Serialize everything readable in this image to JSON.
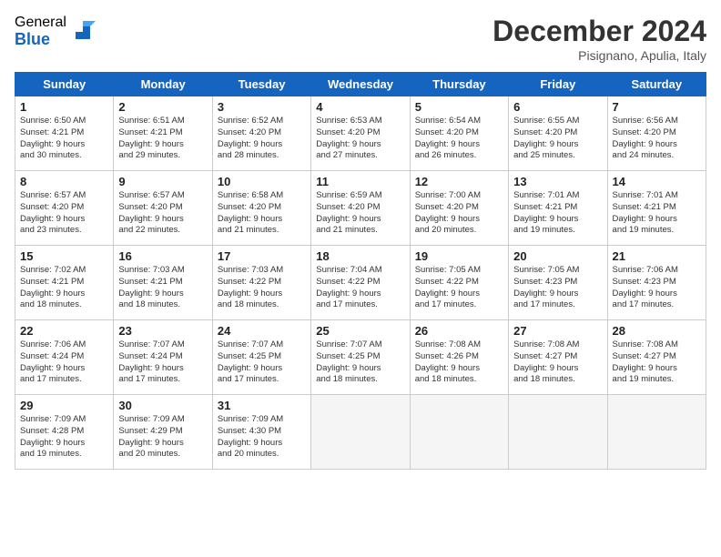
{
  "header": {
    "logo_general": "General",
    "logo_blue": "Blue",
    "title": "December 2024",
    "location": "Pisignano, Apulia, Italy"
  },
  "days_of_week": [
    "Sunday",
    "Monday",
    "Tuesday",
    "Wednesday",
    "Thursday",
    "Friday",
    "Saturday"
  ],
  "weeks": [
    [
      {
        "day": "1",
        "sunrise": "6:50 AM",
        "sunset": "4:21 PM",
        "daylight": "9 hours and 30 minutes."
      },
      {
        "day": "2",
        "sunrise": "6:51 AM",
        "sunset": "4:21 PM",
        "daylight": "9 hours and 29 minutes."
      },
      {
        "day": "3",
        "sunrise": "6:52 AM",
        "sunset": "4:20 PM",
        "daylight": "9 hours and 28 minutes."
      },
      {
        "day": "4",
        "sunrise": "6:53 AM",
        "sunset": "4:20 PM",
        "daylight": "9 hours and 27 minutes."
      },
      {
        "day": "5",
        "sunrise": "6:54 AM",
        "sunset": "4:20 PM",
        "daylight": "9 hours and 26 minutes."
      },
      {
        "day": "6",
        "sunrise": "6:55 AM",
        "sunset": "4:20 PM",
        "daylight": "9 hours and 25 minutes."
      },
      {
        "day": "7",
        "sunrise": "6:56 AM",
        "sunset": "4:20 PM",
        "daylight": "9 hours and 24 minutes."
      }
    ],
    [
      {
        "day": "8",
        "sunrise": "6:57 AM",
        "sunset": "4:20 PM",
        "daylight": "9 hours and 23 minutes."
      },
      {
        "day": "9",
        "sunrise": "6:57 AM",
        "sunset": "4:20 PM",
        "daylight": "9 hours and 22 minutes."
      },
      {
        "day": "10",
        "sunrise": "6:58 AM",
        "sunset": "4:20 PM",
        "daylight": "9 hours and 21 minutes."
      },
      {
        "day": "11",
        "sunrise": "6:59 AM",
        "sunset": "4:20 PM",
        "daylight": "9 hours and 21 minutes."
      },
      {
        "day": "12",
        "sunrise": "7:00 AM",
        "sunset": "4:20 PM",
        "daylight": "9 hours and 20 minutes."
      },
      {
        "day": "13",
        "sunrise": "7:01 AM",
        "sunset": "4:21 PM",
        "daylight": "9 hours and 19 minutes."
      },
      {
        "day": "14",
        "sunrise": "7:01 AM",
        "sunset": "4:21 PM",
        "daylight": "9 hours and 19 minutes."
      }
    ],
    [
      {
        "day": "15",
        "sunrise": "7:02 AM",
        "sunset": "4:21 PM",
        "daylight": "9 hours and 18 minutes."
      },
      {
        "day": "16",
        "sunrise": "7:03 AM",
        "sunset": "4:21 PM",
        "daylight": "9 hours and 18 minutes."
      },
      {
        "day": "17",
        "sunrise": "7:03 AM",
        "sunset": "4:22 PM",
        "daylight": "9 hours and 18 minutes."
      },
      {
        "day": "18",
        "sunrise": "7:04 AM",
        "sunset": "4:22 PM",
        "daylight": "9 hours and 17 minutes."
      },
      {
        "day": "19",
        "sunrise": "7:05 AM",
        "sunset": "4:22 PM",
        "daylight": "9 hours and 17 minutes."
      },
      {
        "day": "20",
        "sunrise": "7:05 AM",
        "sunset": "4:23 PM",
        "daylight": "9 hours and 17 minutes."
      },
      {
        "day": "21",
        "sunrise": "7:06 AM",
        "sunset": "4:23 PM",
        "daylight": "9 hours and 17 minutes."
      }
    ],
    [
      {
        "day": "22",
        "sunrise": "7:06 AM",
        "sunset": "4:24 PM",
        "daylight": "9 hours and 17 minutes."
      },
      {
        "day": "23",
        "sunrise": "7:07 AM",
        "sunset": "4:24 PM",
        "daylight": "9 hours and 17 minutes."
      },
      {
        "day": "24",
        "sunrise": "7:07 AM",
        "sunset": "4:25 PM",
        "daylight": "9 hours and 17 minutes."
      },
      {
        "day": "25",
        "sunrise": "7:07 AM",
        "sunset": "4:25 PM",
        "daylight": "9 hours and 18 minutes."
      },
      {
        "day": "26",
        "sunrise": "7:08 AM",
        "sunset": "4:26 PM",
        "daylight": "9 hours and 18 minutes."
      },
      {
        "day": "27",
        "sunrise": "7:08 AM",
        "sunset": "4:27 PM",
        "daylight": "9 hours and 18 minutes."
      },
      {
        "day": "28",
        "sunrise": "7:08 AM",
        "sunset": "4:27 PM",
        "daylight": "9 hours and 19 minutes."
      }
    ],
    [
      {
        "day": "29",
        "sunrise": "7:09 AM",
        "sunset": "4:28 PM",
        "daylight": "9 hours and 19 minutes."
      },
      {
        "day": "30",
        "sunrise": "7:09 AM",
        "sunset": "4:29 PM",
        "daylight": "9 hours and 20 minutes."
      },
      {
        "day": "31",
        "sunrise": "7:09 AM",
        "sunset": "4:30 PM",
        "daylight": "9 hours and 20 minutes."
      },
      null,
      null,
      null,
      null
    ]
  ]
}
